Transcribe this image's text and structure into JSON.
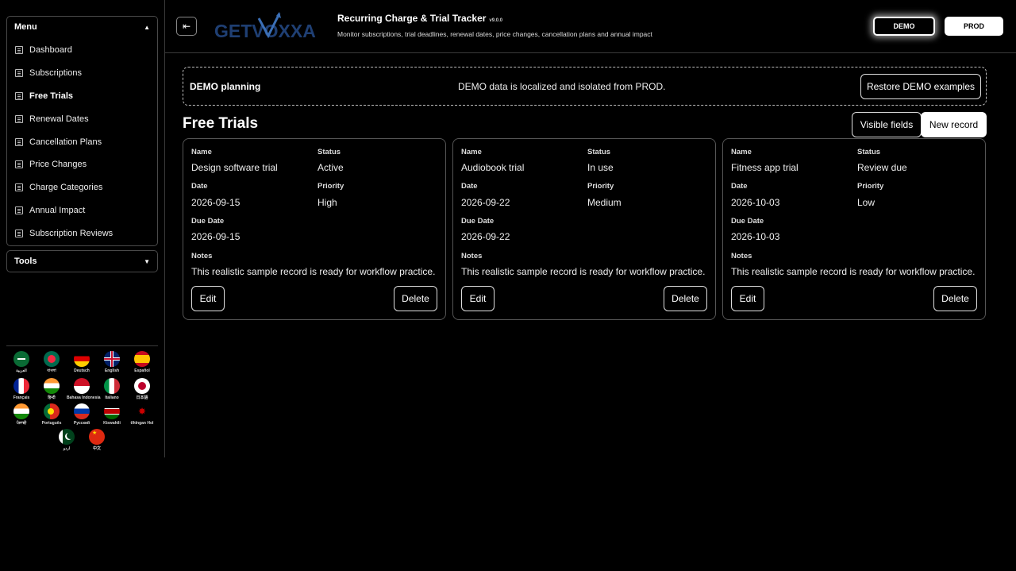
{
  "sidebar": {
    "menu_label": "Menu",
    "tools_label": "Tools",
    "items": [
      {
        "label": "Dashboard"
      },
      {
        "label": "Subscriptions"
      },
      {
        "label": "Free Trials"
      },
      {
        "label": "Renewal Dates"
      },
      {
        "label": "Cancellation Plans"
      },
      {
        "label": "Price Changes"
      },
      {
        "label": "Charge Categories"
      },
      {
        "label": "Annual Impact"
      },
      {
        "label": "Subscription Reviews"
      }
    ],
    "active_item": "Free Trials",
    "languages": [
      {
        "label": "العربية"
      },
      {
        "label": "বাংলা"
      },
      {
        "label": "Deutsch"
      },
      {
        "label": "English"
      },
      {
        "label": "Español"
      },
      {
        "label": "Français"
      },
      {
        "label": "हिन्दी"
      },
      {
        "label": "Bahasa Indonesia"
      },
      {
        "label": "Italiano"
      },
      {
        "label": "日本語"
      },
      {
        "label": "ਪੰਜਾਬੀ"
      },
      {
        "label": "Português"
      },
      {
        "label": "Русский"
      },
      {
        "label": "Kiswahili"
      },
      {
        "label": "tlhIngan Hol"
      },
      {
        "label": "اردو"
      },
      {
        "label": "中文"
      }
    ]
  },
  "header": {
    "logo_text": "GETVOXXA",
    "title": "Recurring Charge & Trial Tracker",
    "version": "v9.0.0",
    "subtitle": "Monitor subscriptions, trial deadlines, renewal dates, price changes, cancellation plans and annual impact",
    "env_demo": "DEMO",
    "env_prod": "PROD",
    "active_env": "DEMO"
  },
  "banner": {
    "title": "DEMO planning",
    "message": "DEMO data is localized and isolated from PROD.",
    "restore_label": "Restore DEMO examples"
  },
  "section": {
    "title": "Free Trials",
    "visible_fields_label": "Visible fields",
    "new_record_label": "New record"
  },
  "field_labels": {
    "name": "Name",
    "status": "Status",
    "date": "Date",
    "priority": "Priority",
    "due_date": "Due Date",
    "notes": "Notes",
    "edit": "Edit",
    "delete": "Delete"
  },
  "cards": [
    {
      "name": "Design software trial",
      "status": "Active",
      "date": "2026-09-15",
      "priority": "High",
      "due_date": "2026-09-15",
      "notes": "This realistic sample record is ready for workflow practice."
    },
    {
      "name": "Audiobook trial",
      "status": "In use",
      "date": "2026-09-22",
      "priority": "Medium",
      "due_date": "2026-09-22",
      "notes": "This realistic sample record is ready for workflow practice."
    },
    {
      "name": "Fitness app trial",
      "status": "Review due",
      "date": "2026-10-03",
      "priority": "Low",
      "due_date": "2026-10-03",
      "notes": "This realistic sample record is ready for workflow practice."
    }
  ],
  "colors": {
    "background": "#000000",
    "text": "#ffffff",
    "border": "#555555",
    "logo_blue": "#3b6fb6",
    "logo_dark": "#1f3f73"
  }
}
